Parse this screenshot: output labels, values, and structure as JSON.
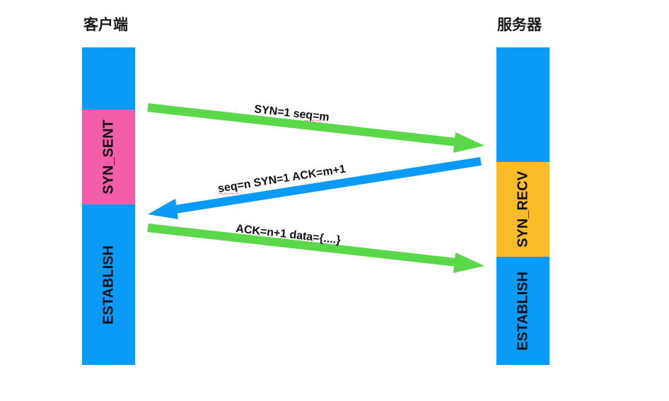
{
  "client": {
    "title": "客户端",
    "states": [
      "SYN_SENT",
      "ESTABLISH"
    ]
  },
  "server": {
    "title": "服务器",
    "states": [
      "SYN_RECV",
      "ESTABLISH"
    ]
  },
  "messages": [
    {
      "label": "SYN=1  seq=m",
      "direction": "client-to-server",
      "color": "#5bd84a"
    },
    {
      "label": "seq=n   SYN=1  ACK=m+1",
      "direction": "server-to-client",
      "color": "#0a9af7"
    },
    {
      "label": "ACK=n+1  data={....}",
      "direction": "client-to-server",
      "color": "#5bd84a"
    }
  ],
  "colors": {
    "timeline": "#0a9af7",
    "syn_sent": "#f25da7",
    "syn_recv": "#f7bc27",
    "forward_arrow": "#5bd84a",
    "back_arrow": "#0a9af7"
  }
}
